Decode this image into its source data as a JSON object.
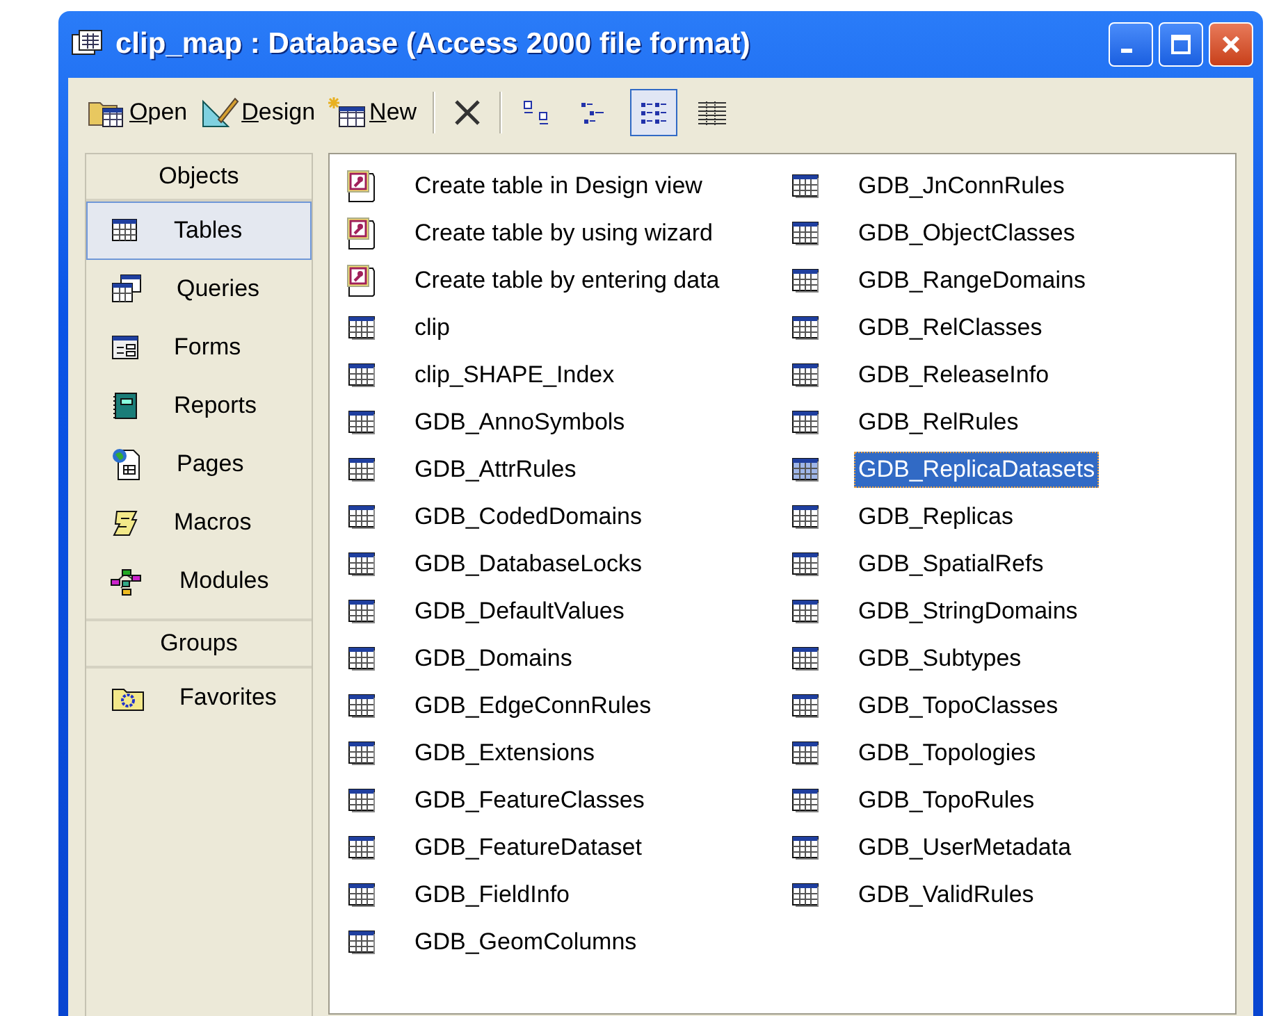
{
  "window": {
    "title": "clip_map : Database (Access 2000 file format)"
  },
  "toolbar": {
    "actions": [
      {
        "kind": "open",
        "label": "Open"
      },
      {
        "kind": "design",
        "label": "Design"
      },
      {
        "kind": "new",
        "label": "New"
      }
    ],
    "views": [
      {
        "kind": "large_icons",
        "selected": false
      },
      {
        "kind": "small_icons",
        "selected": false
      },
      {
        "kind": "list",
        "selected": true
      },
      {
        "kind": "details",
        "selected": false
      }
    ]
  },
  "sidebar": {
    "objects_header": "Objects",
    "items": [
      {
        "kind": "tables",
        "label": "Tables",
        "selected": true
      },
      {
        "kind": "queries",
        "label": "Queries",
        "selected": false
      },
      {
        "kind": "forms",
        "label": "Forms",
        "selected": false
      },
      {
        "kind": "reports",
        "label": "Reports",
        "selected": false
      },
      {
        "kind": "pages",
        "label": "Pages",
        "selected": false
      },
      {
        "kind": "macros",
        "label": "Macros",
        "selected": false
      },
      {
        "kind": "modules",
        "label": "Modules",
        "selected": false
      }
    ],
    "groups_header": "Groups",
    "groups": [
      {
        "kind": "favorites",
        "label": "Favorites",
        "selected": false
      }
    ]
  },
  "objects": [
    {
      "kind": "create",
      "label": "Create table in Design view",
      "selected": false
    },
    {
      "kind": "create",
      "label": "Create table by using wizard",
      "selected": false
    },
    {
      "kind": "create",
      "label": "Create table by entering data",
      "selected": false
    },
    {
      "kind": "table",
      "label": "clip",
      "selected": false
    },
    {
      "kind": "table",
      "label": "clip_SHAPE_Index",
      "selected": false
    },
    {
      "kind": "table",
      "label": "GDB_AnnoSymbols",
      "selected": false
    },
    {
      "kind": "table",
      "label": "GDB_AttrRules",
      "selected": false
    },
    {
      "kind": "table",
      "label": "GDB_CodedDomains",
      "selected": false
    },
    {
      "kind": "table",
      "label": "GDB_DatabaseLocks",
      "selected": false
    },
    {
      "kind": "table",
      "label": "GDB_DefaultValues",
      "selected": false
    },
    {
      "kind": "table",
      "label": "GDB_Domains",
      "selected": false
    },
    {
      "kind": "table",
      "label": "GDB_EdgeConnRules",
      "selected": false
    },
    {
      "kind": "table",
      "label": "GDB_Extensions",
      "selected": false
    },
    {
      "kind": "table",
      "label": "GDB_FeatureClasses",
      "selected": false
    },
    {
      "kind": "table",
      "label": "GDB_FeatureDataset",
      "selected": false
    },
    {
      "kind": "table",
      "label": "GDB_FieldInfo",
      "selected": false
    },
    {
      "kind": "table",
      "label": "GDB_GeomColumns",
      "selected": false
    },
    {
      "kind": "table",
      "label": "GDB_JnConnRules",
      "selected": false
    },
    {
      "kind": "table",
      "label": "GDB_ObjectClasses",
      "selected": false
    },
    {
      "kind": "table",
      "label": "GDB_RangeDomains",
      "selected": false
    },
    {
      "kind": "table",
      "label": "GDB_RelClasses",
      "selected": false
    },
    {
      "kind": "table",
      "label": "GDB_ReleaseInfo",
      "selected": false
    },
    {
      "kind": "table",
      "label": "GDB_RelRules",
      "selected": false
    },
    {
      "kind": "table",
      "label": "GDB_ReplicaDatasets",
      "selected": true
    },
    {
      "kind": "table",
      "label": "GDB_Replicas",
      "selected": false
    },
    {
      "kind": "table",
      "label": "GDB_SpatialRefs",
      "selected": false
    },
    {
      "kind": "table",
      "label": "GDB_StringDomains",
      "selected": false
    },
    {
      "kind": "table",
      "label": "GDB_Subtypes",
      "selected": false
    },
    {
      "kind": "table",
      "label": "GDB_TopoClasses",
      "selected": false
    },
    {
      "kind": "table",
      "label": "GDB_Topologies",
      "selected": false
    },
    {
      "kind": "table",
      "label": "GDB_TopoRules",
      "selected": false
    },
    {
      "kind": "table",
      "label": "GDB_UserMetadata",
      "selected": false
    },
    {
      "kind": "table",
      "label": "GDB_ValidRules",
      "selected": false
    }
  ]
}
